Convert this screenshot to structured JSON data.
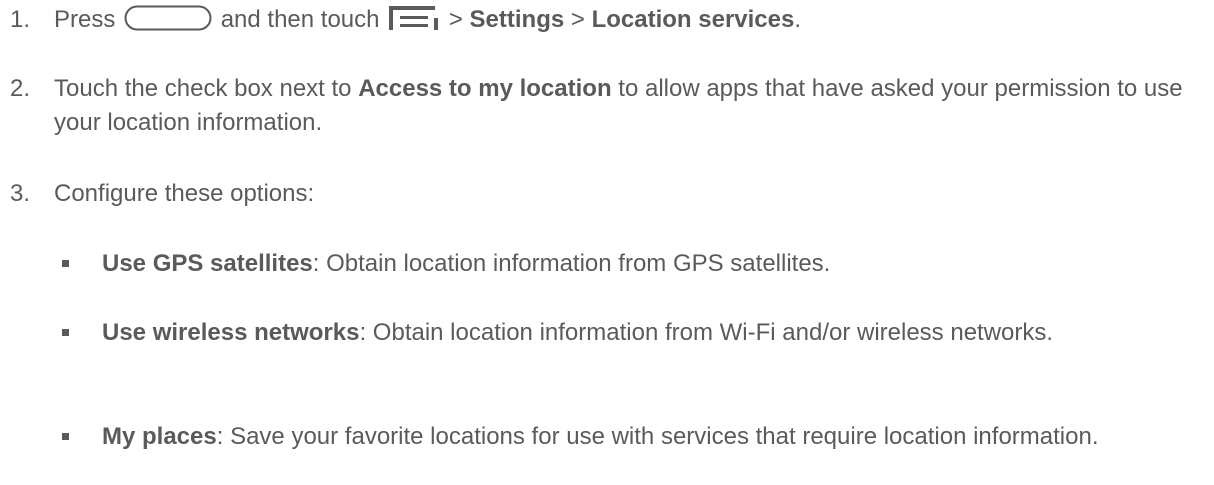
{
  "steps": [
    {
      "number": "1.",
      "press": "Press",
      "then": "and then touch",
      "sep1": ">",
      "settings": "Settings",
      "sep2": ">",
      "location_services": "Location services",
      "end": "."
    },
    {
      "number": "2.",
      "before": "Touch the check box next to",
      "bold": "Access to my location",
      "after": "to allow apps that have asked your permission to use your location information."
    },
    {
      "number": "3.",
      "text": "Configure these options:"
    }
  ],
  "options": [
    {
      "term": "Use GPS satellites",
      "desc": ": Obtain location information from GPS satellites."
    },
    {
      "term": "Use wireless networks",
      "desc": ": Obtain location information from Wi-Fi and/or wireless networks."
    },
    {
      "term": "My places",
      "desc": ": Save your favorite locations for use with services that require location information."
    }
  ],
  "icons": {
    "home_key": "home-key-icon",
    "menu_key": "menu-key-icon"
  },
  "colors": {
    "text": "#5a5a5a",
    "background": "#ffffff"
  }
}
